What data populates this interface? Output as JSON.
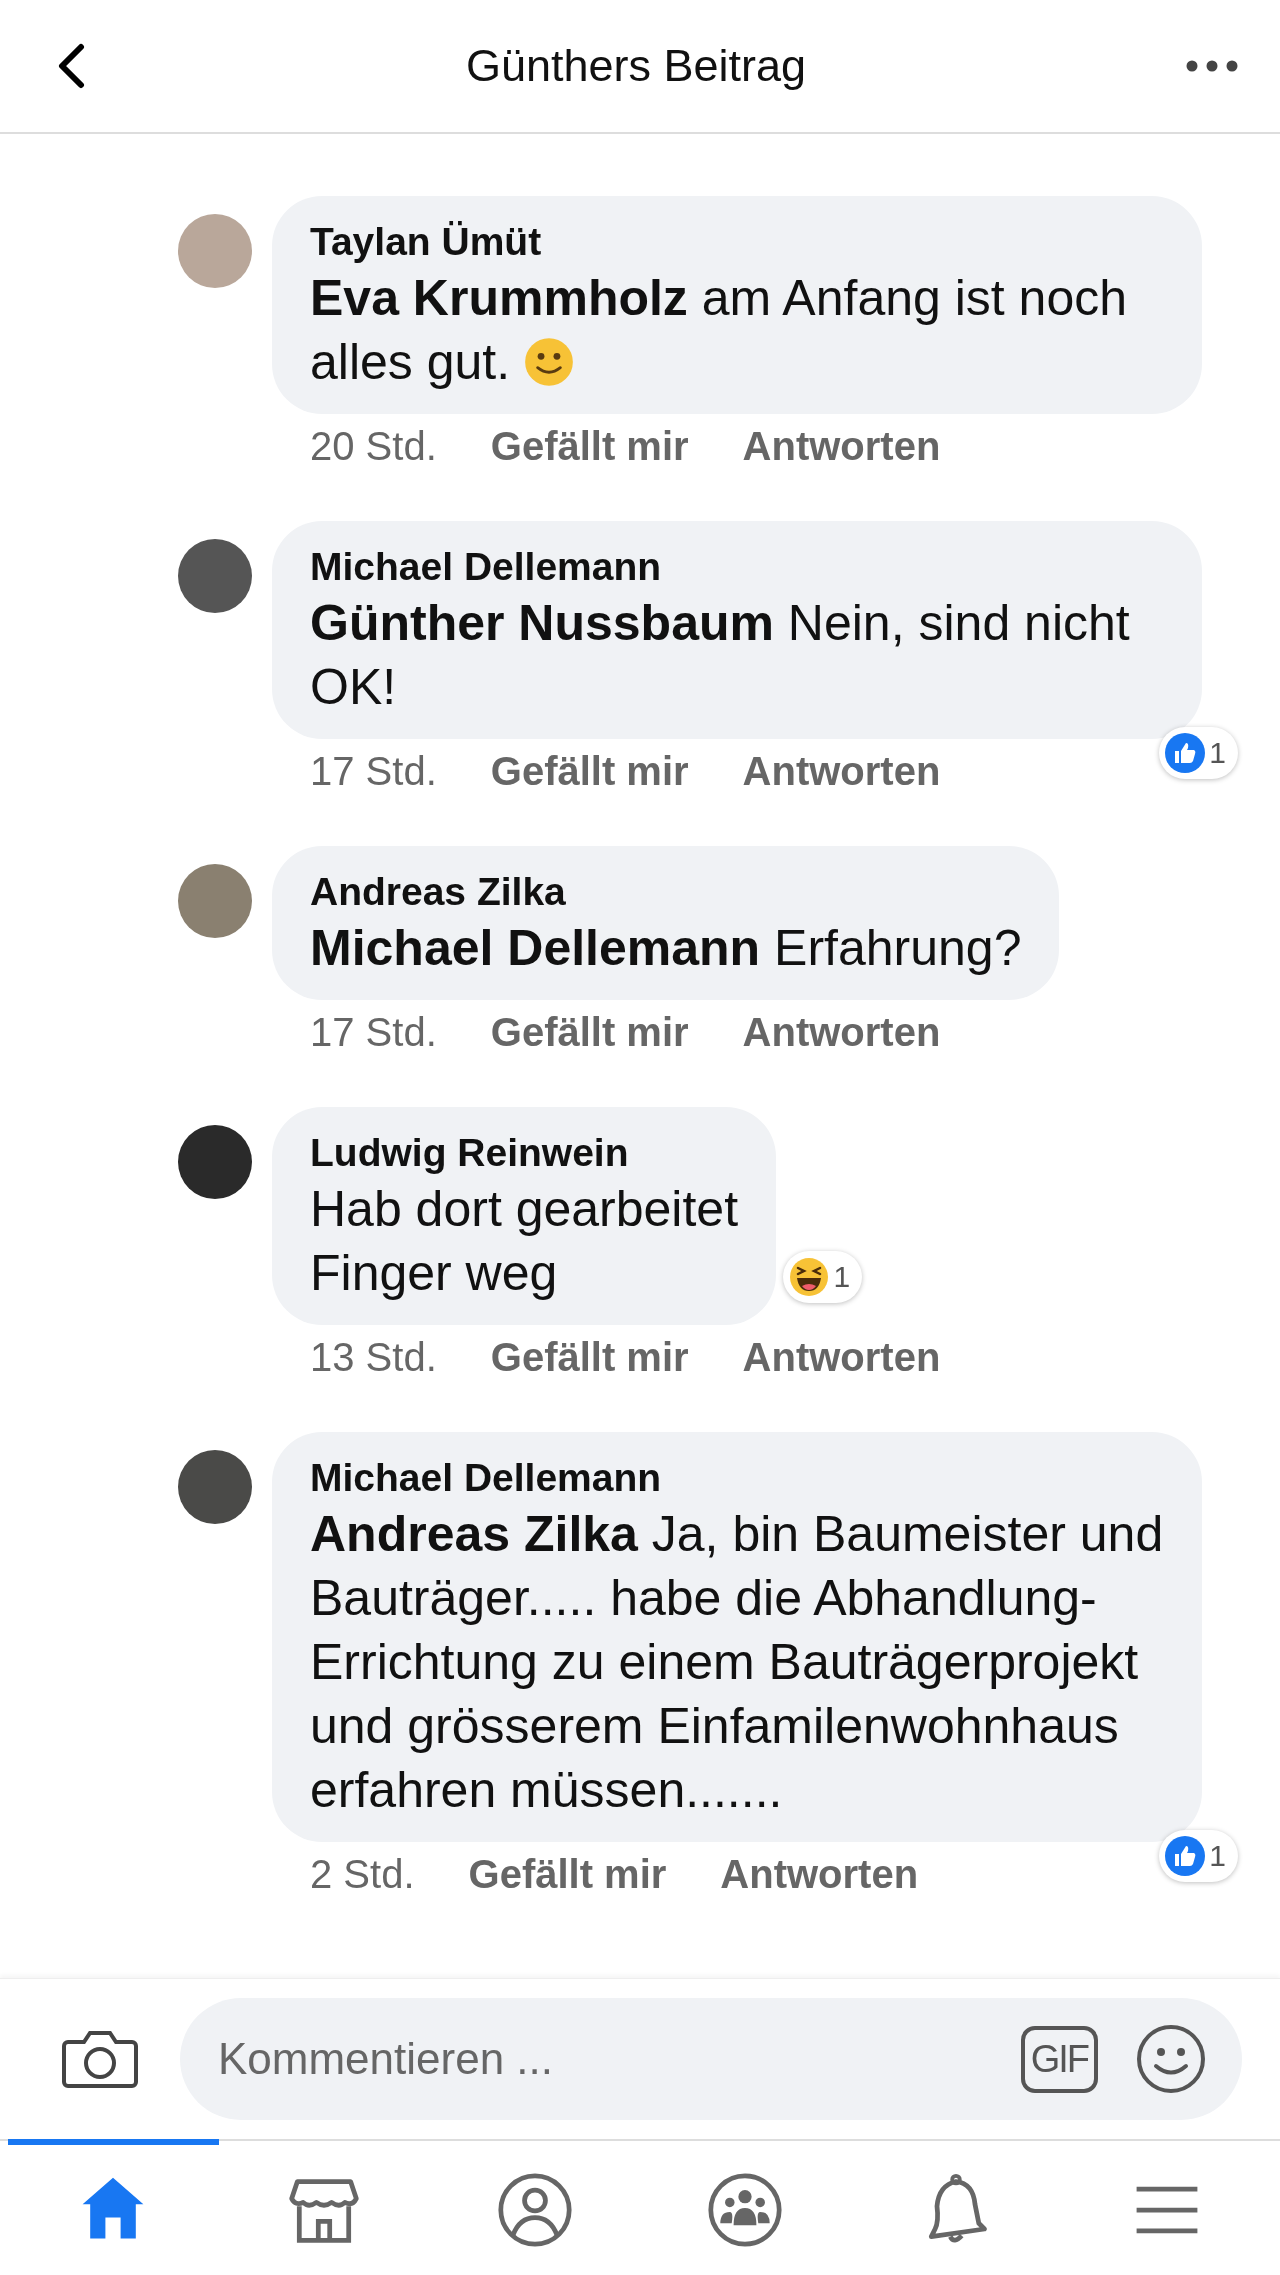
{
  "header": {
    "title": "Günthers Beitrag"
  },
  "comments": [
    {
      "author": "Taylan Ümüt",
      "text": "**Eva Krummholz** am Anfang ist noch alles gut.",
      "emoji": true,
      "time": "20 Std.",
      "like": "Gefällt mir",
      "reply": "Antworten"
    },
    {
      "author": "Michael Dellemann",
      "text": "**Günther Nussbaum** Nein, sind nicht OK!",
      "time": "17 Std.",
      "like": "Gefällt mir",
      "reply": "Antworten",
      "reaction": {
        "kind": "like",
        "count": "1"
      }
    },
    {
      "author": "Andreas Zilka",
      "text": "**Michael Dellemann** Erfahrung?",
      "time": "17 Std.",
      "like": "Gefällt mir",
      "reply": "Antworten"
    },
    {
      "author": "Ludwig Reinwein",
      "text": "Hab dort gearbeitet\nFinger weg",
      "time": "13 Std.",
      "like": "Gefällt mir",
      "reply": "Antworten",
      "reaction": {
        "kind": "haha",
        "count": "1"
      }
    },
    {
      "author": "Michael Dellemann",
      "text": "**Andreas Zilka** Ja, bin Baumeister und Bauträger..... habe die Abhandlung-Errichtung zu einem Bauträgerprojekt und grösserem Einfamilenwohnhaus erfahren müssen.......",
      "time": "2 Std.",
      "like": "Gefällt mir",
      "reply": "Antworten",
      "reaction": {
        "kind": "like",
        "count": "1"
      }
    }
  ],
  "composer": {
    "placeholder": "Kommentieren ...",
    "gif": "GIF"
  },
  "tabs": [
    {
      "kind": "home",
      "selected": true
    },
    {
      "kind": "marketplace",
      "selected": false
    },
    {
      "kind": "profile",
      "selected": false
    },
    {
      "kind": "groups",
      "selected": false
    },
    {
      "kind": "notifications",
      "selected": false
    },
    {
      "kind": "menu",
      "selected": false
    }
  ]
}
